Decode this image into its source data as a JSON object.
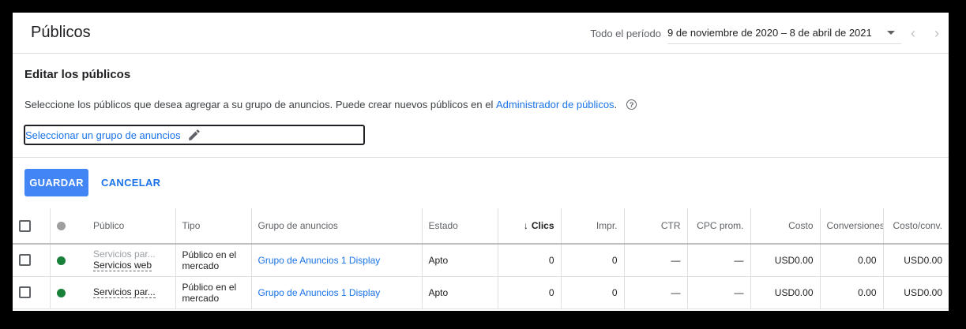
{
  "header": {
    "title": "Públicos",
    "period_label": "Todo el período",
    "period_range": "9 de noviembre de 2020 – 8 de abril de 2021"
  },
  "edit": {
    "title": "Editar los públicos",
    "description": "Seleccione los públicos que desea agregar a su grupo de anuncios. Puede crear nuevos públicos en el",
    "link": "Administrador de públicos",
    "period": ".",
    "help_icon": "?",
    "selector_text": "Seleccionar un grupo de anuncios"
  },
  "buttons": {
    "save": "GUARDAR",
    "cancel": "CANCELAR"
  },
  "table": {
    "headers": {
      "publico": "Público",
      "tipo": "Tipo",
      "grupo": "Grupo de anuncios",
      "estado": "Estado",
      "clics": "Clics",
      "impr": "Impr.",
      "ctr": "CTR",
      "cpc": "CPC prom.",
      "costo": "Costo",
      "conversiones": "Conversiones",
      "costo_conv": "Costo/conv."
    },
    "rows": [
      {
        "publico_sub": "Servicios par...",
        "publico": "Servicios web",
        "tipo": "Público en el mercado",
        "grupo": "Grupo de Anuncios 1 Display",
        "estado": "Apto",
        "clics": "0",
        "impr": "0",
        "ctr": "—",
        "cpc": "—",
        "costo": "USD0.00",
        "conversiones": "0.00",
        "costo_conv": "USD0.00"
      },
      {
        "publico_sub": "",
        "publico": "Servicios par...",
        "tipo": "Público en el mercado",
        "grupo": "Grupo de Anuncios 1 Display",
        "estado": "Apto",
        "clics": "0",
        "impr": "0",
        "ctr": "—",
        "cpc": "—",
        "costo": "USD0.00",
        "conversiones": "0.00",
        "costo_conv": "USD0.00"
      }
    ]
  },
  "colors": {
    "accent": "#1a73e8",
    "save_button": "#4285f4",
    "status_green": "#188038"
  }
}
